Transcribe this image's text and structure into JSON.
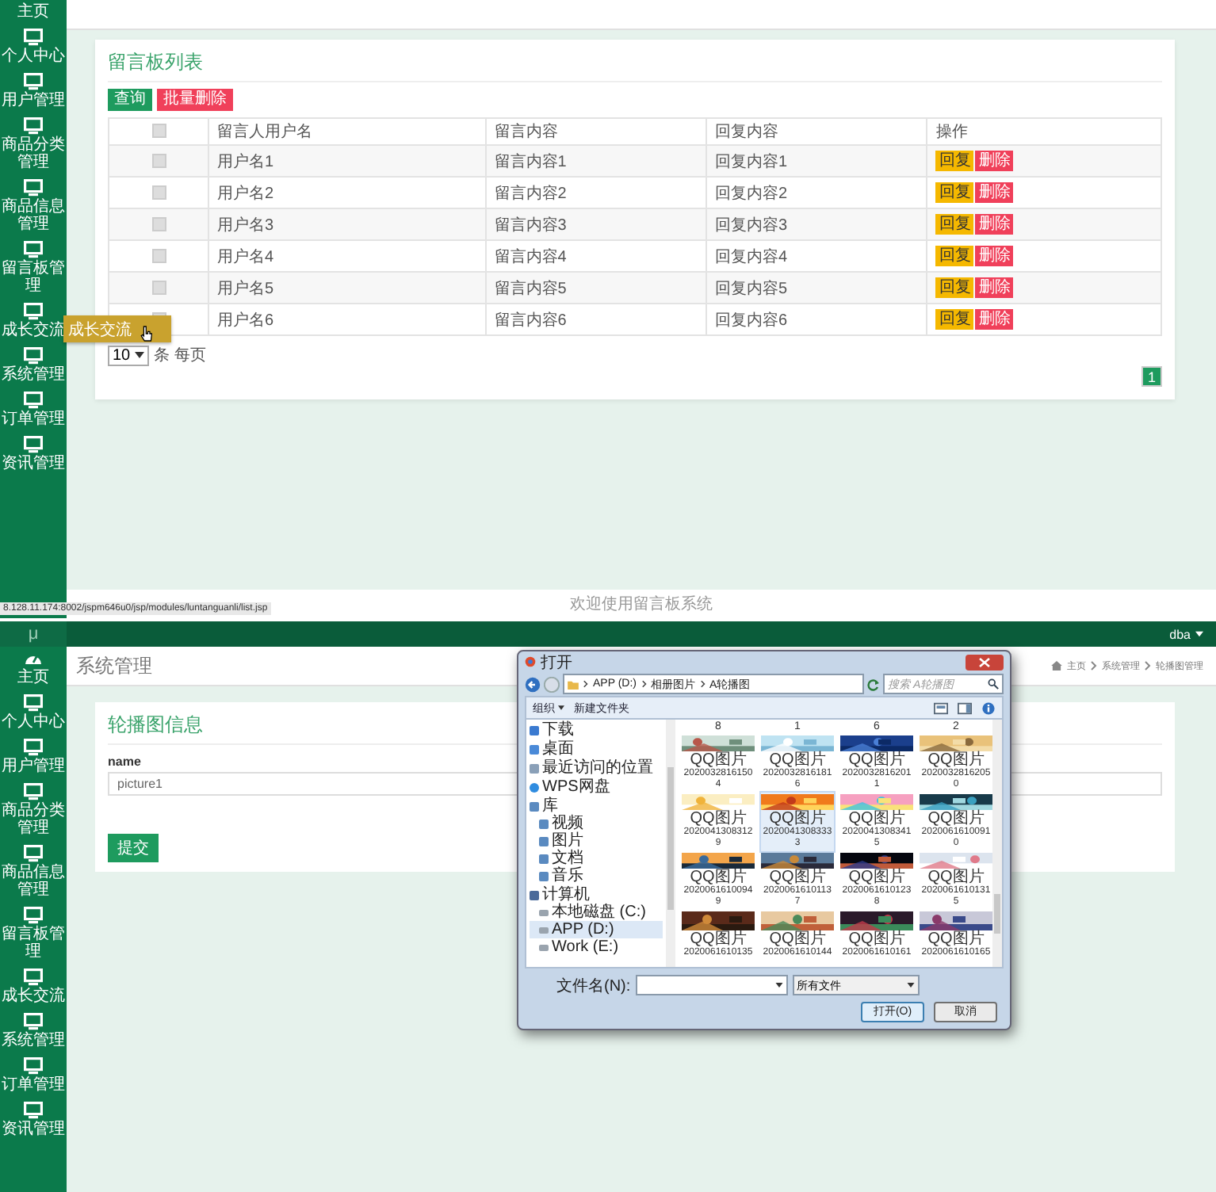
{
  "message_board_screen": {
    "sidebar": {
      "items": [
        {
          "label": "主页"
        },
        {
          "label": "个人中心"
        },
        {
          "label": "用户管理"
        },
        {
          "label": "商品分类管理"
        },
        {
          "label": "商品信息管理"
        },
        {
          "label": "留言板管理"
        },
        {
          "label": "成长交流",
          "tooltip": "成长交流"
        },
        {
          "label": "系统管理"
        },
        {
          "label": "订单管理"
        },
        {
          "label": "资讯管理"
        }
      ]
    },
    "card": {
      "title": "留言板列表",
      "buttons": [
        {
          "label": "查询",
          "kind": "primary"
        },
        {
          "label": "批量删除",
          "kind": "danger"
        }
      ],
      "table": {
        "select_all_checked": false,
        "columns": [
          "留言人用户名",
          "留言内容",
          "回复内容",
          "操作"
        ],
        "rows": [
          {
            "checked": false,
            "cells": [
              "用户名1",
              "留言内容1",
              "回复内容1"
            ],
            "actions": [
              {
                "label": "回复",
                "kind": "warning"
              },
              {
                "label": "删除",
                "kind": "danger"
              }
            ]
          },
          {
            "checked": false,
            "cells": [
              "用户名2",
              "留言内容2",
              "回复内容2"
            ],
            "actions": [
              {
                "label": "回复",
                "kind": "warning"
              },
              {
                "label": "删除",
                "kind": "danger"
              }
            ]
          },
          {
            "checked": false,
            "cells": [
              "用户名3",
              "留言内容3",
              "回复内容3"
            ],
            "actions": [
              {
                "label": "回复",
                "kind": "warning"
              },
              {
                "label": "删除",
                "kind": "danger"
              }
            ]
          },
          {
            "checked": false,
            "cells": [
              "用户名4",
              "留言内容4",
              "回复内容4"
            ],
            "actions": [
              {
                "label": "回复",
                "kind": "warning"
              },
              {
                "label": "删除",
                "kind": "danger"
              }
            ]
          },
          {
            "checked": false,
            "cells": [
              "用户名5",
              "留言内容5",
              "回复内容5"
            ],
            "actions": [
              {
                "label": "回复",
                "kind": "warning"
              },
              {
                "label": "删除",
                "kind": "danger"
              }
            ]
          },
          {
            "checked": false,
            "cells": [
              "用户名6",
              "留言内容6",
              "回复内容6"
            ],
            "actions": [
              {
                "label": "回复",
                "kind": "warning"
              },
              {
                "label": "删除",
                "kind": "danger"
              }
            ]
          }
        ]
      },
      "page_size": "10",
      "page_size_suffix": "条 每页",
      "pages": [
        {
          "label": "1",
          "selected": true
        }
      ]
    },
    "footer": "欢迎使用留言板系统",
    "status_url": "8.128.11.174:8002/jspm646u0/jsp/modules/luntanguanli/list.jsp"
  },
  "carousel_screen": {
    "top_bar": {
      "logo": "μ",
      "user": "dba"
    },
    "sidebar": {
      "items": [
        {
          "label": "主页"
        },
        {
          "label": "个人中心"
        },
        {
          "label": "用户管理"
        },
        {
          "label": "商品分类管理"
        },
        {
          "label": "商品信息管理"
        },
        {
          "label": "留言板管理"
        },
        {
          "label": "成长交流"
        },
        {
          "label": "系统管理"
        },
        {
          "label": "订单管理"
        },
        {
          "label": "资讯管理"
        }
      ]
    },
    "page_title": "系统管理",
    "breadcrumb": [
      "主页",
      "系统管理",
      "轮播图管理"
    ],
    "form": {
      "title": "轮播图信息",
      "field_label": "name",
      "field_value": "picture1",
      "submit": "提交"
    },
    "file_dialog": {
      "title": "打开",
      "path": [
        "APP (D:)",
        "相册图片",
        "A轮播图"
      ],
      "search_placeholder": "搜索 A轮播图",
      "toolbar": [
        "组织",
        "新建文件夹"
      ],
      "nav": [
        {
          "label": "下载"
        },
        {
          "label": "桌面"
        },
        {
          "label": "最近访问的位置"
        },
        {
          "label": "WPS网盘"
        },
        {
          "label": "库",
          "children": [
            {
              "label": "视频"
            },
            {
              "label": "图片"
            },
            {
              "label": "文档"
            },
            {
              "label": "音乐"
            }
          ]
        },
        {
          "label": "计算机",
          "children": [
            {
              "label": "本地磁盘 (C:)",
              "selected": false
            },
            {
              "label": "APP (D:)",
              "selected": true
            },
            {
              "label": "Work (E:)",
              "selected": false
            }
          ]
        }
      ],
      "partial_row": [
        "8",
        "1",
        "6",
        "2"
      ],
      "files": [
        {
          "name": "QQ图片",
          "number": "20200328161504",
          "selected": false
        },
        {
          "name": "QQ图片",
          "number": "20200328161816",
          "selected": false
        },
        {
          "name": "QQ图片",
          "number": "20200328162011",
          "selected": false
        },
        {
          "name": "QQ图片",
          "number": "20200328162050",
          "selected": false
        },
        {
          "name": "QQ图片",
          "number": "20200413083129",
          "selected": false
        },
        {
          "name": "QQ图片",
          "number": "20200413083333",
          "selected": true
        },
        {
          "name": "QQ图片",
          "number": "20200413083415",
          "selected": false
        },
        {
          "name": "QQ图片",
          "number": "20200616100910",
          "selected": false
        },
        {
          "name": "QQ图片",
          "number": "20200616100949",
          "selected": false
        },
        {
          "name": "QQ图片",
          "number": "20200616101137",
          "selected": false
        },
        {
          "name": "QQ图片",
          "number": "20200616101238",
          "selected": false
        },
        {
          "name": "QQ图片",
          "number": "20200616101315",
          "selected": false
        },
        {
          "name": "QQ图片",
          "number": "2020061610135",
          "selected": false
        },
        {
          "name": "QQ图片",
          "number": "2020061610144",
          "selected": false
        },
        {
          "name": "QQ图片",
          "number": "2020061610161",
          "selected": false
        },
        {
          "name": "QQ图片",
          "number": "2020061610165",
          "selected": false
        }
      ],
      "filename_label": "文件名(N):",
      "file_type": "所有文件",
      "buttons": [
        {
          "label": "打开(O)",
          "kind": "default"
        },
        {
          "label": "取消",
          "kind": "normal"
        }
      ]
    }
  }
}
